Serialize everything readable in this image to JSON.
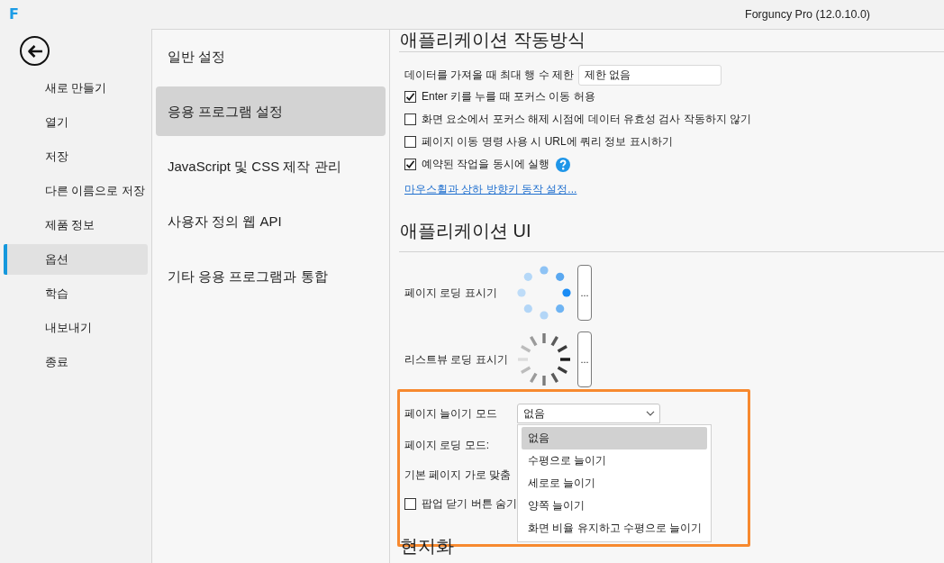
{
  "title_bar": {
    "logo": "F",
    "title": "Forguncy Pro (12.0.10.0)"
  },
  "backstage_menu": {
    "items": [
      {
        "label": "새로 만들기",
        "selected": false
      },
      {
        "label": "열기",
        "selected": false
      },
      {
        "label": "저장",
        "selected": false
      },
      {
        "label": "다른 이름으로 저장",
        "selected": false
      },
      {
        "label": "제품 정보",
        "selected": false
      },
      {
        "label": "옵션",
        "selected": true
      },
      {
        "label": "학습",
        "selected": false
      },
      {
        "label": "내보내기",
        "selected": false
      },
      {
        "label": "종료",
        "selected": false
      }
    ]
  },
  "settings_nav": {
    "items": [
      {
        "label": "일반 설정",
        "selected": false
      },
      {
        "label": "응용 프로그램 설정",
        "selected": true
      },
      {
        "label": "JavaScript 및 CSS 제작 관리",
        "selected": false
      },
      {
        "label": "사용자 정의 웹 API",
        "selected": false
      },
      {
        "label": "기타 응용 프로그램과 통합",
        "selected": false
      }
    ]
  },
  "behavior_section": {
    "heading": "애플리케이션 작동방식",
    "max_rows": {
      "label": "데이터를 가져올 때 최대 행 수 제한",
      "value": "제한 없음"
    },
    "options": [
      {
        "label": "Enter 키를 누를 때 포커스 이동 허용",
        "checked": true,
        "help": false
      },
      {
        "label": "화면 요소에서 포커스 해제 시점에 데이터 유효성 검사 작동하지 않기",
        "checked": false,
        "help": false
      },
      {
        "label": "페이지 이동 명령 사용 시 URL에 쿼리 정보 표시하기",
        "checked": false,
        "help": false
      },
      {
        "label": "예약된 작업을 동시에 실행",
        "checked": true,
        "help": true
      }
    ],
    "link": "마우스휠과 상하 방향키 동작 설정..."
  },
  "ui_section": {
    "heading": "애플리케이션 UI",
    "indicators": [
      {
        "label": "페이지 로딩 표시기",
        "kind": "dots",
        "button": "..."
      },
      {
        "label": "리스트뷰 로딩 표시기",
        "kind": "dashes",
        "button": "..."
      }
    ],
    "stretch_mode": {
      "label": "페이지 늘이기 모드",
      "value": "없음",
      "expanded": true,
      "options": [
        {
          "label": "없음",
          "selected": true
        },
        {
          "label": "수평으로 늘이기",
          "selected": false
        },
        {
          "label": "세로로 늘이기",
          "selected": false
        },
        {
          "label": "양쪽 늘이기",
          "selected": false
        },
        {
          "label": "화면 비율 유지하고 수평으로 늘이기",
          "selected": false
        }
      ]
    },
    "loading_mode": {
      "label": "페이지 로딩 모드:"
    },
    "horizontal_alignment": {
      "label": "기본 페이지 가로 맞춤"
    },
    "hide_popup_close": {
      "label": "팝업 닫기 버튼 숨기",
      "checked": false
    }
  },
  "localization_section": {
    "heading": "현지화"
  }
}
